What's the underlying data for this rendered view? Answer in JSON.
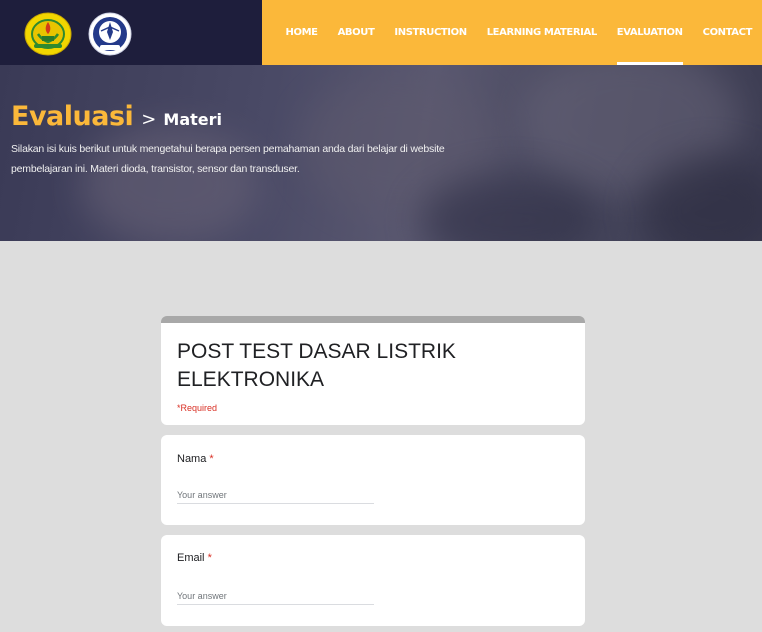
{
  "nav": {
    "items": [
      {
        "label": "HOME",
        "active": false
      },
      {
        "label": "ABOUT",
        "active": false
      },
      {
        "label": "INSTRUCTION",
        "active": false
      },
      {
        "label": "LEARNING MATERIAL",
        "active": false
      },
      {
        "label": "EVALUATION",
        "active": true
      },
      {
        "label": "CONTACT",
        "active": false
      }
    ]
  },
  "hero": {
    "title": "Evaluasi",
    "separator": ">",
    "subtitle": "Materi",
    "description": "Silakan isi kuis berikut untuk mengetahui berapa persen pemahaman anda dari belajar di website pembelajaran ini. Materi dioda, transistor, sensor dan transduser."
  },
  "form": {
    "title": "POST TEST DASAR LISTRIK ELEKTRONIKA",
    "required_note": "*Required",
    "questions": [
      {
        "label": "Nama",
        "star": "*",
        "placeholder": "Your answer"
      },
      {
        "label": "Email",
        "star": "*",
        "placeholder": "Your answer"
      }
    ]
  },
  "colors": {
    "nav_dark": "#1e1e3c",
    "accent": "#fbb83a",
    "required": "#d93025"
  }
}
